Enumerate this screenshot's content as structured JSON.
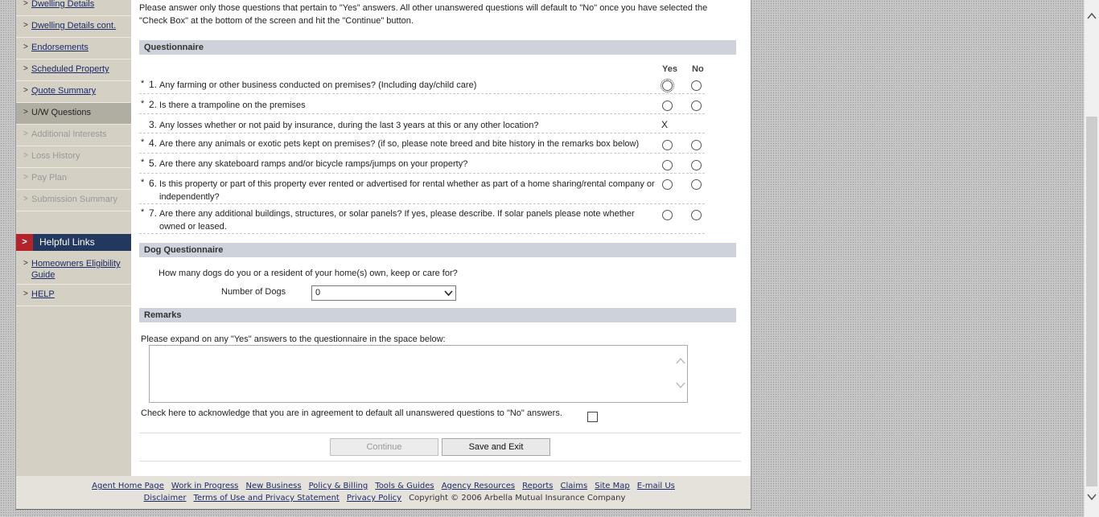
{
  "sidebar": {
    "items": [
      {
        "label": "Dwelling Details",
        "state": "link"
      },
      {
        "label": "Dwelling Details cont.",
        "state": "link"
      },
      {
        "label": "Endorsements",
        "state": "link"
      },
      {
        "label": "Scheduled Property",
        "state": "link"
      },
      {
        "label": "Quote Summary",
        "state": "link"
      },
      {
        "label": "U/W Questions",
        "state": "active"
      },
      {
        "label": "Additional Interests",
        "state": "disabled"
      },
      {
        "label": "Loss History",
        "state": "disabled"
      },
      {
        "label": "Pay Plan",
        "state": "disabled"
      },
      {
        "label": "Submission Summary",
        "state": "disabled"
      }
    ],
    "helpful_links_title": "Helpful Links",
    "helpful_links": [
      {
        "label": "Homeowners Eligibility Guide"
      },
      {
        "label": "HELP"
      }
    ]
  },
  "intro_text": "Please answer only those questions that pertain to \"Yes\" answers. All other unanswered questions will default to \"No\" once you have selected the \"Check Box\" at the bottom of the screen and hit the \"Continue\" button.",
  "questionnaire": {
    "title": "Questionnaire",
    "yes_label": "Yes",
    "no_label": "No",
    "questions": [
      {
        "required": "*",
        "num": "1.",
        "text": "Any farming or other business conducted on premises? (Including day/child care)",
        "answer_type": "radio"
      },
      {
        "required": "*",
        "num": "2.",
        "text": "Is there a trampoline on the premises",
        "answer_type": "radio"
      },
      {
        "required": "",
        "num": "3.",
        "text": "Any losses whether or not paid by insurance, during the last 3 years at this or any other location?",
        "answer_type": "mark",
        "mark": "X"
      },
      {
        "required": "*",
        "num": "4.",
        "text": "Are there any animals or exotic pets kept on premises? (if so, please note breed and bite history in the remarks box below)",
        "answer_type": "radio"
      },
      {
        "required": "*",
        "num": "5.",
        "text": "Are there any skateboard ramps and/or bicycle ramps/jumps on your property?",
        "answer_type": "radio"
      },
      {
        "required": "*",
        "num": "6.",
        "text": "Is this property or part of this property ever rented or advertised for rental whether as part of a home sharing/rental company or independently?",
        "answer_type": "radio"
      },
      {
        "required": "*",
        "num": "7.",
        "text": "Are there any additional buildings, structures, or solar panels? If yes, please describe. If solar panels please note whether owned or leased.",
        "answer_type": "radio"
      }
    ]
  },
  "dog_questionnaire": {
    "title": "Dog Questionnaire",
    "question": "How many dogs do you or a resident of your home(s) own, keep or care for?",
    "number_label": "Number of Dogs",
    "selected": "0"
  },
  "remarks": {
    "title": "Remarks",
    "prompt": "Please expand on any \"Yes\" answers to the questionnaire in the space below:",
    "value": ""
  },
  "acknowledge_text": "Check here to acknowledge that you are in agreement to default all unanswered questions to \"No\" answers.",
  "buttons": {
    "continue": "Continue",
    "save_exit": "Save and Exit"
  },
  "footer": {
    "row1": [
      "Agent Home Page",
      "Work in Progress",
      "New Business",
      "Policy & Billing",
      "Tools & Guides",
      "Agency Resources",
      "Reports",
      "Claims",
      "Site Map",
      "E-mail Us"
    ],
    "row2": [
      "Disclaimer",
      "Terms of Use and Privacy Statement",
      "Privacy Policy"
    ],
    "copyright": "Copyright © 2006 Arbella Mutual Insurance Company"
  },
  "icons": {
    "chevron": "chevron-right-icon",
    "scroll_up": "scroll-up-icon",
    "scroll_down": "scroll-down-icon",
    "dropdown": "dropdown-arrow-icon"
  },
  "colors": {
    "helpful_links_bg": "#23385e",
    "helpful_links_accent": "#b2232a",
    "section_header_bg": "#cdd2db",
    "sidebar_bg": "#d4d0c4"
  }
}
